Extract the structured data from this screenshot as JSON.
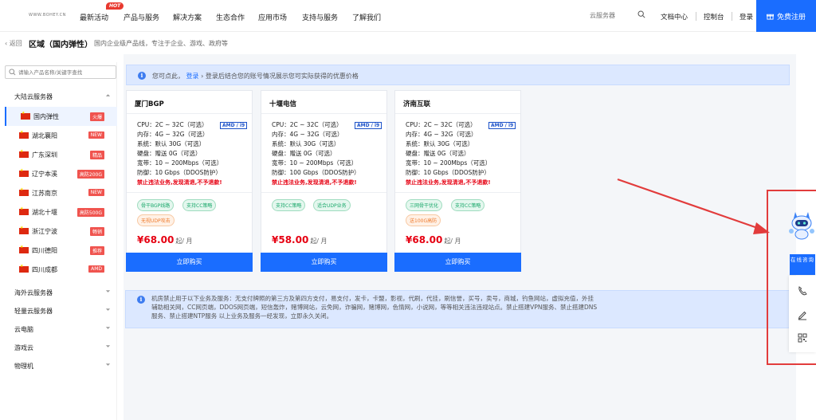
{
  "header": {
    "logo": "WWW.BOHEY.CN",
    "nav": [
      "最新活动",
      "产品与服务",
      "解决方案",
      "生态合作",
      "应用市场",
      "支持与服务",
      "了解我们"
    ],
    "hot_badge": "HOT",
    "search_placeholder": "云服务器",
    "links": [
      "文档中心",
      "控制台",
      "登录"
    ],
    "register": "免费注册"
  },
  "breadcrumb": {
    "back": "返回",
    "title": "区域（国内弹性）",
    "subtitle": "国内企业级产品线，专注于企业、游戏、政府等"
  },
  "sidebar": {
    "search_placeholder": "请输入产品名称/关键字查找",
    "groups": [
      {
        "label": "大陆云服务器",
        "expanded": true
      },
      {
        "label": "海外云服务器"
      },
      {
        "label": "轻量云服务器"
      },
      {
        "label": "云电脑"
      },
      {
        "label": "游戏云"
      },
      {
        "label": "物理机"
      }
    ],
    "items": [
      {
        "label": "国内弹性",
        "tag": "火爆",
        "active": true
      },
      {
        "label": "湖北襄阳",
        "tag": "NEW"
      },
      {
        "label": "广东深圳",
        "tag": "精品"
      },
      {
        "label": "辽宁本溪",
        "tag": "高防200G"
      },
      {
        "label": "江苏南京",
        "tag": "NEW"
      },
      {
        "label": "湖北十堰",
        "tag": "高防500G"
      },
      {
        "label": "浙江宁波",
        "tag": "畅销"
      },
      {
        "label": "四川德阳",
        "tag": "推荐"
      },
      {
        "label": "四川成都",
        "tag": "AMD"
      }
    ]
  },
  "notice": {
    "prefix": "您可点此，",
    "link": "登录",
    "suffix": "登录后结合您的账号情况展示您可实际获得的优惠价格"
  },
  "cards": [
    {
      "title": "厦门BGP",
      "badge": "AMD / i9",
      "specs": [
        "CPU：2C ~ 32C（可选）",
        "内存：4G ~ 32G（可选）",
        "系统：默认 30G（可选）",
        "硬盘：赠送 0G（可选）",
        "宽带：10 ~ 200Mbps（可选）",
        "防御：10 Gbps（DDOS防护）"
      ],
      "warning": "禁止违法业务,发现清退,不予退款!",
      "tags": [
        {
          "text": "骨干BGP线路",
          "color": "green"
        },
        {
          "text": "支持CC策略",
          "color": "green"
        },
        {
          "text": "无视UDP攻击",
          "color": "orange"
        }
      ],
      "price": "¥68.00",
      "unit": "起/ 月",
      "buy": "立即购买"
    },
    {
      "title": "十堰电信",
      "badge": "AMD / i9",
      "specs": [
        "CPU：2C ~ 32C（可选）",
        "内存：4G ~ 32G（可选）",
        "系统：默认 30G（可选）",
        "硬盘：赠送 0G（可选）",
        "宽带：10 ~ 200Mbps（可选）",
        "防御：100 Gbps（DDOS防护）"
      ],
      "warning": "禁止违法业务,发现清退,不予退款!",
      "tags": [
        {
          "text": "支持CC策略",
          "color": "green"
        },
        {
          "text": "适合UDP业务",
          "color": "green"
        }
      ],
      "price": "¥58.00",
      "unit": "起/ 月",
      "buy": "立即购买"
    },
    {
      "title": "济南互联",
      "badge": "AMD / i9",
      "specs": [
        "CPU：2C ~ 32C（可选）",
        "内存：4G ~ 32G（可选）",
        "系统：默认 30G（可选）",
        "硬盘：赠送 0G（可选）",
        "宽带：10 ~ 200Mbps（可选）",
        "防御：10 Gbps（DDOS防护）"
      ],
      "warning": "禁止违法业务,发现清退,不予退款!",
      "tags": [
        {
          "text": "三网骨干优化",
          "color": "green"
        },
        {
          "text": "支持CC策略",
          "color": "green"
        },
        {
          "text": "送100G高防",
          "color": "orange"
        }
      ],
      "price": "¥68.00",
      "unit": "起/ 月",
      "buy": "立即购买"
    }
  ],
  "policy": "机房禁止用于以下业务及服务：无支付牌照的第三方及第四方支付，易支付，发卡，卡盟，影视，代刷，代挂，刷信誉，买号，卖号，商城，钓鱼网站，虚拟充值，外挂辅助相关网，CC网页端，DDOS网页端，短信轰炸，赌博网站，云免网，诈骗网，赌博网，色情网，小说网，等等相关违法违规站点。禁止搭建VPN服务、禁止搭建DNS服务、禁止搭建NTP服务 以上业务及服务一经发现，立即永久关闭。",
  "float": {
    "online": "在线咨询"
  },
  "colors": {
    "primary": "#1a6dff",
    "price": "#e60012",
    "annotation": "#e23c3c"
  }
}
